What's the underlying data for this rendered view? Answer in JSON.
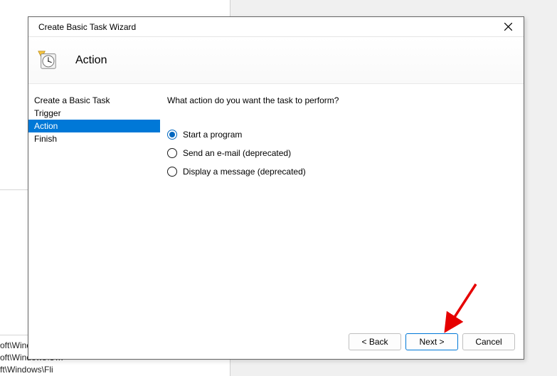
{
  "bg": {
    "line1": "oft\\Wind…",
    "line2": "oft\\Windows\\U…",
    "line3": "ft\\Windows\\Fli"
  },
  "dialog": {
    "title": "Create Basic Task Wizard",
    "header": "Action"
  },
  "steps": [
    {
      "label": "Create a Basic Task",
      "selected": false
    },
    {
      "label": "Trigger",
      "selected": false
    },
    {
      "label": "Action",
      "selected": true
    },
    {
      "label": "Finish",
      "selected": false
    }
  ],
  "content": {
    "prompt": "What action do you want the task to perform?",
    "options": [
      {
        "label": "Start a program",
        "checked": true
      },
      {
        "label": "Send an e-mail (deprecated)",
        "checked": false
      },
      {
        "label": "Display a message (deprecated)",
        "checked": false
      }
    ]
  },
  "buttons": {
    "back": "< Back",
    "next": "Next >",
    "cancel": "Cancel"
  }
}
